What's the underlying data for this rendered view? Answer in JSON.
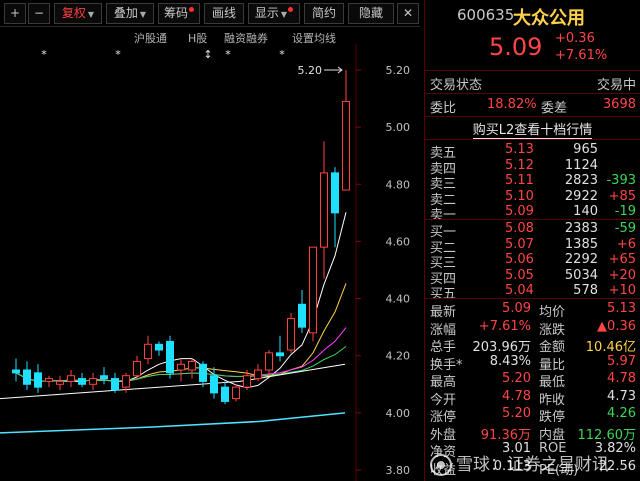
{
  "toolbar": {
    "plus": "+",
    "minus": "−",
    "fuquan": "复权",
    "diejia": "叠加",
    "chouma": "筹码",
    "huaxian": "画线",
    "xianshi": "显示",
    "jianyue": "简约",
    "yincang": "隐藏",
    "close": "✕"
  },
  "indicators": {
    "hugu": "沪股通",
    "hgu": "H股",
    "rongzi": "融资融券",
    "setma": "设置均线"
  },
  "chart_data": {
    "type": "candlestick",
    "ylim": [
      3.8,
      5.2
    ],
    "y_ticks": [
      "5.20",
      "5.00",
      "4.80",
      "4.60",
      "4.40",
      "4.20",
      "4.00",
      "3.80"
    ],
    "high_marker": "5.20",
    "markers": [
      "*",
      "*",
      "↕",
      "*",
      "*"
    ],
    "candles": [
      {
        "o": 4.15,
        "h": 4.19,
        "l": 4.11,
        "c": 4.14
      },
      {
        "o": 4.15,
        "h": 4.18,
        "l": 4.08,
        "c": 4.1
      },
      {
        "o": 4.14,
        "h": 4.17,
        "l": 4.07,
        "c": 4.09
      },
      {
        "o": 4.11,
        "h": 4.13,
        "l": 4.09,
        "c": 4.12
      },
      {
        "o": 4.1,
        "h": 4.13,
        "l": 4.08,
        "c": 4.11
      },
      {
        "o": 4.11,
        "h": 4.15,
        "l": 4.09,
        "c": 4.13
      },
      {
        "o": 4.12,
        "h": 4.14,
        "l": 4.09,
        "c": 4.1
      },
      {
        "o": 4.1,
        "h": 4.14,
        "l": 4.08,
        "c": 4.12
      },
      {
        "o": 4.13,
        "h": 4.16,
        "l": 4.1,
        "c": 4.12
      },
      {
        "o": 4.12,
        "h": 4.14,
        "l": 4.07,
        "c": 4.08
      },
      {
        "o": 4.09,
        "h": 4.14,
        "l": 4.07,
        "c": 4.13
      },
      {
        "o": 4.13,
        "h": 4.2,
        "l": 4.12,
        "c": 4.18
      },
      {
        "o": 4.19,
        "h": 4.27,
        "l": 4.17,
        "c": 4.24
      },
      {
        "o": 4.24,
        "h": 4.25,
        "l": 4.2,
        "c": 4.22
      },
      {
        "o": 4.25,
        "h": 4.27,
        "l": 4.12,
        "c": 4.14
      },
      {
        "o": 4.15,
        "h": 4.19,
        "l": 4.11,
        "c": 4.17
      },
      {
        "o": 4.15,
        "h": 4.19,
        "l": 4.12,
        "c": 4.18
      },
      {
        "o": 4.17,
        "h": 4.18,
        "l": 4.09,
        "c": 4.11
      },
      {
        "o": 4.13,
        "h": 4.16,
        "l": 4.05,
        "c": 4.07
      },
      {
        "o": 4.09,
        "h": 4.11,
        "l": 4.03,
        "c": 4.04
      },
      {
        "o": 4.05,
        "h": 4.1,
        "l": 4.04,
        "c": 4.09
      },
      {
        "o": 4.09,
        "h": 4.15,
        "l": 4.08,
        "c": 4.13
      },
      {
        "o": 4.12,
        "h": 4.17,
        "l": 4.11,
        "c": 4.15
      },
      {
        "o": 4.15,
        "h": 4.22,
        "l": 4.13,
        "c": 4.21
      },
      {
        "o": 4.21,
        "h": 4.27,
        "l": 4.18,
        "c": 4.2
      },
      {
        "o": 4.22,
        "h": 4.35,
        "l": 4.21,
        "c": 4.33
      },
      {
        "o": 4.38,
        "h": 4.43,
        "l": 4.28,
        "c": 4.3
      },
      {
        "o": 4.28,
        "h": 4.58,
        "l": 4.25,
        "c": 4.58
      },
      {
        "o": 4.58,
        "h": 4.95,
        "l": 4.47,
        "c": 4.84
      },
      {
        "o": 4.84,
        "h": 4.86,
        "l": 4.58,
        "c": 4.7
      },
      {
        "o": 4.78,
        "h": 5.2,
        "l": 4.78,
        "c": 5.09
      }
    ]
  },
  "panel": {
    "code": "600635",
    "name": "大众公用",
    "price": "5.09",
    "change": "+0.36",
    "change_pct": "+7.61%",
    "status_label": "交易状态",
    "status_value": "交易中",
    "weibi_label": "委比",
    "weibi_value": "18.82%",
    "weicha_label": "委差",
    "weicha_value": "3698",
    "l2_link": "购买L2查看十档行情",
    "asks": [
      {
        "label": "卖五",
        "price": "5.13",
        "vol": "965",
        "delta": ""
      },
      {
        "label": "卖四",
        "price": "5.12",
        "vol": "1124",
        "delta": ""
      },
      {
        "label": "卖三",
        "price": "5.11",
        "vol": "2823",
        "delta": "-393"
      },
      {
        "label": "卖二",
        "price": "5.10",
        "vol": "2922",
        "delta": "+85"
      },
      {
        "label": "卖一",
        "price": "5.09",
        "vol": "140",
        "delta": "-19"
      }
    ],
    "bids": [
      {
        "label": "买一",
        "price": "5.08",
        "vol": "2383",
        "delta": "-59"
      },
      {
        "label": "买二",
        "price": "5.07",
        "vol": "1385",
        "delta": "+6"
      },
      {
        "label": "买三",
        "price": "5.06",
        "vol": "2292",
        "delta": "+65"
      },
      {
        "label": "买四",
        "price": "5.05",
        "vol": "5034",
        "delta": "+20"
      },
      {
        "label": "买五",
        "price": "5.04",
        "vol": "578",
        "delta": "+10"
      }
    ],
    "stats": [
      {
        "l1": "最新",
        "v1": "5.09",
        "c1": "red",
        "l2": "均价",
        "v2": "5.13",
        "c2": "red"
      },
      {
        "l1": "涨幅",
        "v1": "+7.61%",
        "c1": "red",
        "l2": "涨跌",
        "v2": "▲0.36",
        "c2": "red"
      },
      {
        "l1": "总手",
        "v1": "203.96万",
        "c1": "white",
        "l2": "金额",
        "v2": "10.46亿",
        "c2": "yellow"
      },
      {
        "l1": "换手*",
        "v1": "8.43%",
        "c1": "white",
        "l2": "量比",
        "v2": "5.97",
        "c2": "red"
      },
      {
        "l1": "最高",
        "v1": "5.20",
        "c1": "red",
        "l2": "最低",
        "v2": "4.78",
        "c2": "red"
      },
      {
        "l1": "今开",
        "v1": "4.78",
        "c1": "red",
        "l2": "昨收",
        "v2": "4.73",
        "c2": "white"
      },
      {
        "l1": "涨停",
        "v1": "5.20",
        "c1": "red",
        "l2": "跌停",
        "v2": "4.26",
        "c2": "green"
      },
      {
        "l1": "外盘",
        "v1": "91.36万",
        "c1": "red",
        "l2": "内盘",
        "v2": "112.60万",
        "c2": "green"
      },
      {
        "l1": "净资",
        "v1": "3.01",
        "c1": "white",
        "l2": "ROE",
        "v2": "3.82%",
        "c2": "white"
      },
      {
        "l1": "收益",
        "v1": "0.113",
        "c1": "white",
        "l2": "PE(动)",
        "v2": "22.56",
        "c2": "white"
      }
    ],
    "watermark": "雪球：证券之星财讯"
  }
}
